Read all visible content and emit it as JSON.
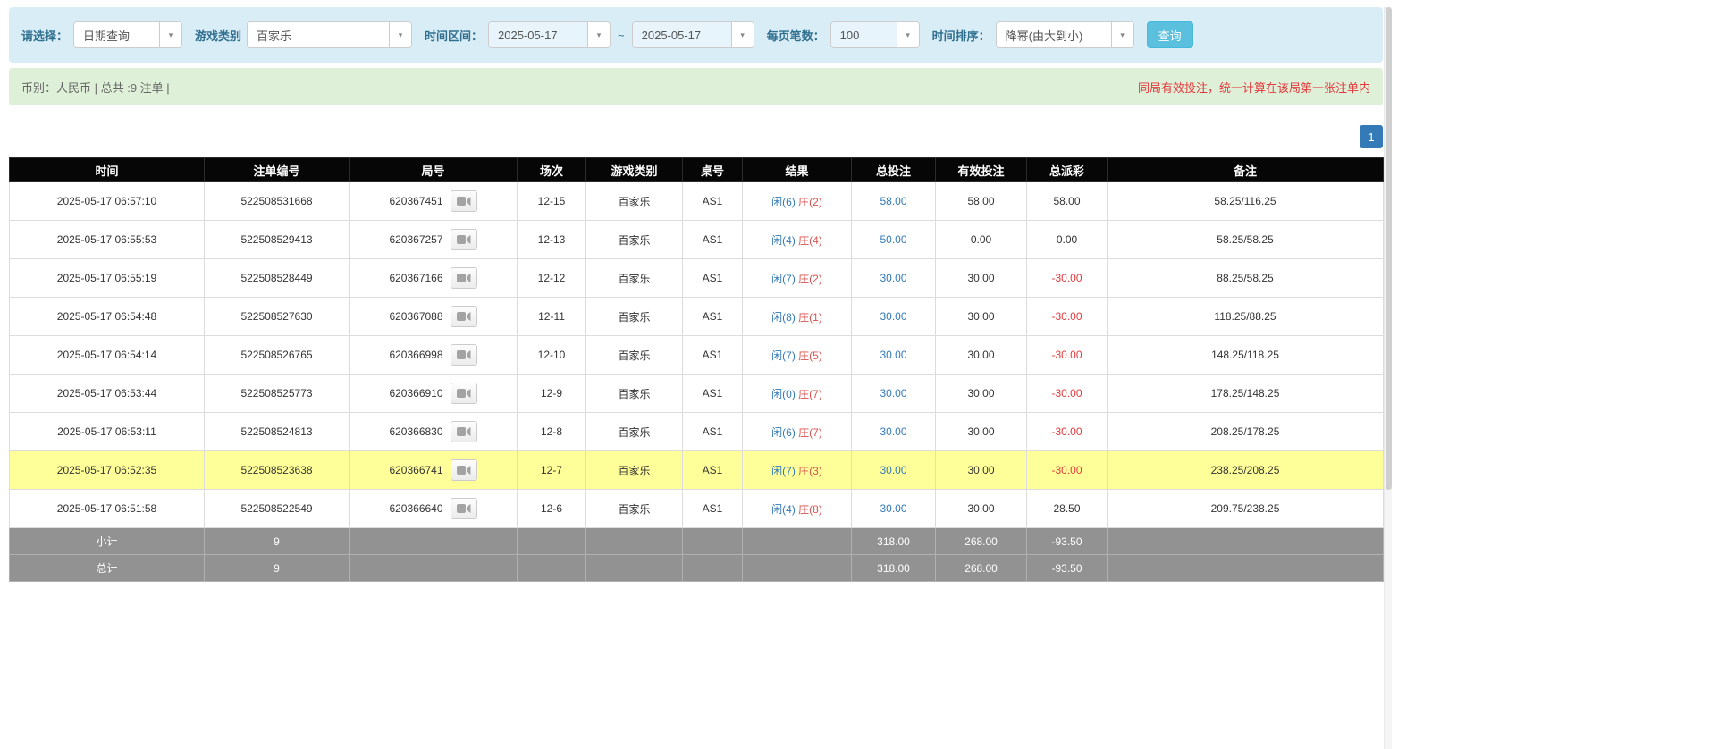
{
  "filter": {
    "select_label": "请选择：",
    "query_type": "日期查询",
    "game_label": "游戏类别",
    "game_type": "百家乐",
    "range_label": "时间区间：",
    "date_from": "2025-05-17",
    "range_separator": "~",
    "date_to": "2025-05-17",
    "page_size_label": "每页笔数：",
    "page_size": "100",
    "sort_label": "时间排序：",
    "sort_order": "降幂(由大到小)",
    "search_button": "查询"
  },
  "summary": {
    "info": "币别：人民币 | 总共 :9 注单 |",
    "notice": "同局有效投注，统一计算在该局第一张注单内"
  },
  "pagination": {
    "current_page": "1"
  },
  "icons": {
    "round_replay": "video-camera-icon",
    "select_caret": "▾"
  },
  "colors": {
    "player_blue": "#337ab7",
    "banker_red": "#d9534f",
    "negative_red": "#e4393c",
    "highlight_yellow": "#ffff99",
    "header_black": "#060606",
    "footer_gray": "#929292",
    "search_cyan": "#5bc0de",
    "page_blue": "#337ab7"
  },
  "table": {
    "headers": [
      "时间",
      "注单编号",
      "局号",
      "场次",
      "游戏类别",
      "桌号",
      "结果",
      "总投注",
      "有效投注",
      "总派彩",
      "备注"
    ],
    "rows": [
      {
        "time": "2025-05-17 06:57:10",
        "bet_no": "522508531668",
        "round_no": "620367451",
        "session": "12-15",
        "game": "百家乐",
        "table_no": "AS1",
        "player": "闲(6)",
        "banker": "庄(2)",
        "total_bet": "58.00",
        "valid_bet": "58.00",
        "payout": "58.00",
        "note": "58.25/116.25",
        "highlight": false
      },
      {
        "time": "2025-05-17 06:55:53",
        "bet_no": "522508529413",
        "round_no": "620367257",
        "session": "12-13",
        "game": "百家乐",
        "table_no": "AS1",
        "player": "闲(4)",
        "banker": "庄(4)",
        "total_bet": "50.00",
        "valid_bet": "0.00",
        "payout": "0.00",
        "note": "58.25/58.25",
        "highlight": false
      },
      {
        "time": "2025-05-17 06:55:19",
        "bet_no": "522508528449",
        "round_no": "620367166",
        "session": "12-12",
        "game": "百家乐",
        "table_no": "AS1",
        "player": "闲(7)",
        "banker": "庄(2)",
        "total_bet": "30.00",
        "valid_bet": "30.00",
        "payout": "-30.00",
        "note": "88.25/58.25",
        "highlight": false
      },
      {
        "time": "2025-05-17 06:54:48",
        "bet_no": "522508527630",
        "round_no": "620367088",
        "session": "12-11",
        "game": "百家乐",
        "table_no": "AS1",
        "player": "闲(8)",
        "banker": "庄(1)",
        "total_bet": "30.00",
        "valid_bet": "30.00",
        "payout": "-30.00",
        "note": "118.25/88.25",
        "highlight": false
      },
      {
        "time": "2025-05-17 06:54:14",
        "bet_no": "522508526765",
        "round_no": "620366998",
        "session": "12-10",
        "game": "百家乐",
        "table_no": "AS1",
        "player": "闲(7)",
        "banker": "庄(5)",
        "total_bet": "30.00",
        "valid_bet": "30.00",
        "payout": "-30.00",
        "note": "148.25/118.25",
        "highlight": false
      },
      {
        "time": "2025-05-17 06:53:44",
        "bet_no": "522508525773",
        "round_no": "620366910",
        "session": "12-9",
        "game": "百家乐",
        "table_no": "AS1",
        "player": "闲(0)",
        "banker": "庄(7)",
        "total_bet": "30.00",
        "valid_bet": "30.00",
        "payout": "-30.00",
        "note": "178.25/148.25",
        "highlight": false
      },
      {
        "time": "2025-05-17 06:53:11",
        "bet_no": "522508524813",
        "round_no": "620366830",
        "session": "12-8",
        "game": "百家乐",
        "table_no": "AS1",
        "player": "闲(6)",
        "banker": "庄(7)",
        "total_bet": "30.00",
        "valid_bet": "30.00",
        "payout": "-30.00",
        "note": "208.25/178.25",
        "highlight": false
      },
      {
        "time": "2025-05-17 06:52:35",
        "bet_no": "522508523638",
        "round_no": "620366741",
        "session": "12-7",
        "game": "百家乐",
        "table_no": "AS1",
        "player": "闲(7)",
        "banker": "庄(3)",
        "total_bet": "30.00",
        "valid_bet": "30.00",
        "payout": "-30.00",
        "note": "238.25/208.25",
        "highlight": true
      },
      {
        "time": "2025-05-17 06:51:58",
        "bet_no": "522508522549",
        "round_no": "620366640",
        "session": "12-6",
        "game": "百家乐",
        "table_no": "AS1",
        "player": "闲(4)",
        "banker": "庄(8)",
        "total_bet": "30.00",
        "valid_bet": "30.00",
        "payout": "28.50",
        "note": "209.75/238.25",
        "highlight": false
      }
    ],
    "footer": [
      {
        "label": "小计",
        "count": "9",
        "total_bet": "318.00",
        "valid_bet": "268.00",
        "payout": "-93.50"
      },
      {
        "label": "总计",
        "count": "9",
        "total_bet": "318.00",
        "valid_bet": "268.00",
        "payout": "-93.50"
      }
    ]
  }
}
